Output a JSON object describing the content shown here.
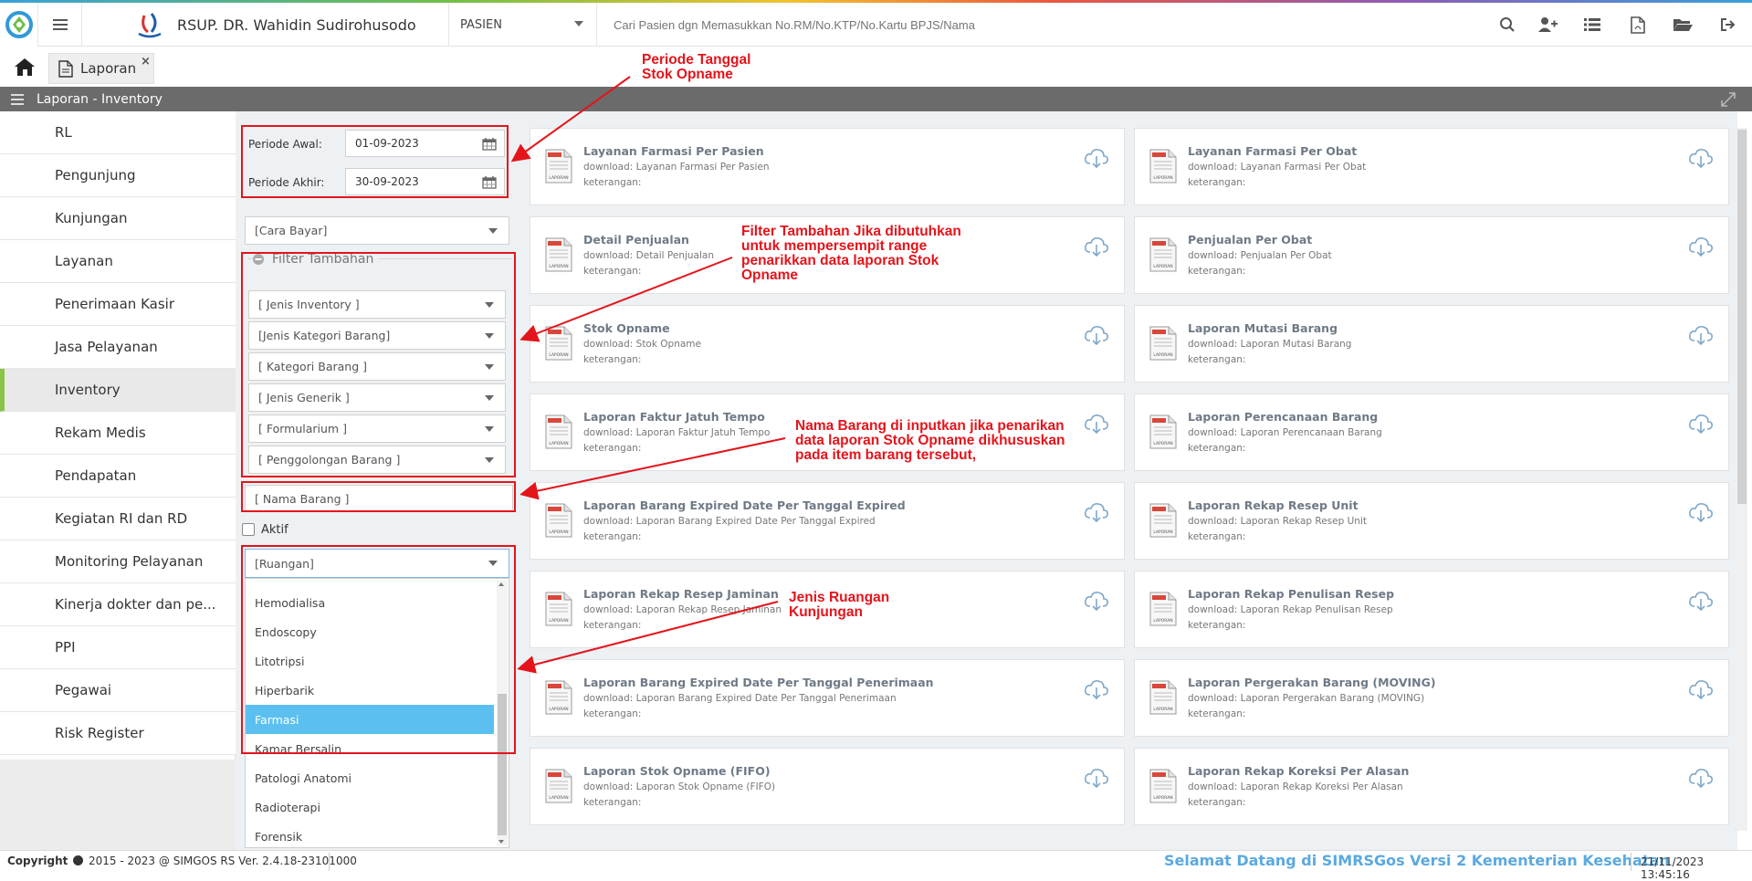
{
  "app": {
    "brand_title": "RSUP. DR. Wahidin Sudirohusodo",
    "patient_select_value": "PASIEN",
    "patient_search_placeholder": "Cari Pasien dgn Memasukkan No.RM/No.KTP/No.Kartu BPJS/Nama"
  },
  "tabs": {
    "laporan_label": "Laporan",
    "close_glyph": "×"
  },
  "section_header": {
    "title": "Laporan - Inventory"
  },
  "sidebar": {
    "items": [
      {
        "label": "RL"
      },
      {
        "label": "Pengunjung"
      },
      {
        "label": "Kunjungan"
      },
      {
        "label": "Layanan"
      },
      {
        "label": "Penerimaan Kasir"
      },
      {
        "label": "Jasa Pelayanan"
      },
      {
        "label": "Inventory"
      },
      {
        "label": "Rekam Medis"
      },
      {
        "label": "Pendapatan"
      },
      {
        "label": "Kegiatan RI dan RD"
      },
      {
        "label": "Monitoring Pelayanan"
      },
      {
        "label": "Kinerja dokter dan pe..."
      },
      {
        "label": "PPI"
      },
      {
        "label": "Pegawai"
      },
      {
        "label": "Risk Register"
      }
    ],
    "active": "Inventory"
  },
  "filters": {
    "periode_awal_label": "Periode Awal:",
    "periode_awal_value": "01-09-2023",
    "periode_akhir_label": "Periode Akhir:",
    "periode_akhir_value": "30-09-2023",
    "cara_bayar": "[Cara Bayar]",
    "filter_tambahan_legend": "Filter Tambahan",
    "jenis_inventory": "[ Jenis Inventory ]",
    "jenis_kategori_barang": "[Jenis Kategori Barang]",
    "kategori_barang": "[ Kategori Barang ]",
    "jenis_generik": "[ Jenis Generik ]",
    "formularium": "[ Formularium ]",
    "penggolongan_barang": "[ Penggolongan Barang ]",
    "nama_barang_placeholder": "[ Nama Barang ]",
    "aktif_label": "Aktif",
    "ruangan_placeholder": "[Ruangan]",
    "ruangan_options": [
      "Hemodialisa",
      "Endoscopy",
      "Litotripsi",
      "Hiperbarik",
      "Farmasi",
      "Kamar Bersalin",
      "Patologi Anatomi",
      "Radioterapi",
      "Forensik"
    ],
    "ruangan_highlighted": "Farmasi"
  },
  "reports": [
    {
      "title": "Layanan Farmasi Per Pasien",
      "download": "download: Layanan Farmasi Per Pasien",
      "ket": "keterangan:"
    },
    {
      "title": "Layanan Farmasi Per Obat",
      "download": "download: Layanan Farmasi Per Obat",
      "ket": "keterangan:"
    },
    {
      "title": "Detail Penjualan",
      "download": "download: Detail Penjualan",
      "ket": "keterangan:"
    },
    {
      "title": "Penjualan Per Obat",
      "download": "download: Penjualan Per Obat",
      "ket": "keterangan:"
    },
    {
      "title": "Stok Opname",
      "download": "download: Stok Opname",
      "ket": "keterangan:"
    },
    {
      "title": "Laporan Mutasi Barang",
      "download": "download: Laporan Mutasi Barang",
      "ket": "keterangan:"
    },
    {
      "title": "Laporan Faktur Jatuh Tempo",
      "download": "download: Laporan Faktur Jatuh Tempo",
      "ket": "keterangan:"
    },
    {
      "title": "Laporan Perencanaan Barang",
      "download": "download: Laporan Perencanaan Barang",
      "ket": "keterangan:"
    },
    {
      "title": "Laporan Barang Expired Date Per Tanggal Expired",
      "download": "download: Laporan Barang Expired Date Per Tanggal Expired",
      "ket": "keterangan:"
    },
    {
      "title": "Laporan Rekap Resep Unit",
      "download": "download: Laporan Rekap Resep Unit",
      "ket": "keterangan:"
    },
    {
      "title": "Laporan Rekap Resep Jaminan",
      "download": "download: Laporan Rekap Resep Jaminan",
      "ket": "keterangan:"
    },
    {
      "title": "Laporan Rekap Penulisan Resep",
      "download": "download: Laporan Rekap Penulisan Resep",
      "ket": "keterangan:"
    },
    {
      "title": "Laporan Barang Expired Date Per Tanggal Penerimaan",
      "download": "download: Laporan Barang Expired Date Per Tanggal Penerimaan",
      "ket": "keterangan:"
    },
    {
      "title": "Laporan Pergerakan Barang (MOVING)",
      "download": "download: Laporan Pergerakan Barang (MOVING)",
      "ket": "keterangan:"
    },
    {
      "title": "Laporan Stok Opname (FIFO)",
      "download": "download: Laporan Stok Opname (FIFO)",
      "ket": "keterangan:"
    },
    {
      "title": "Laporan Rekap Koreksi Per Alasan",
      "download": "download: Laporan Rekap Koreksi Per Alasan",
      "ket": "keterangan:"
    }
  ],
  "pdf_icon_label": "LAPORAN",
  "annotations": {
    "periode": "Periode Tanggal\nStok Opname",
    "filter": "Filter Tambahan Jika dibutuhkan\nuntuk mempersempit range\npenarikkan data laporan Stok\nOpname",
    "nama_barang": "Nama Barang di inputkan jika penarikan\ndata laporan Stok Opname dikhususkan\npada item barang tersebut,",
    "ruangan": "Jenis Ruangan\nKunjungan"
  },
  "footer": {
    "copyright_label": "Copyright",
    "copyright_text": "2015 - 2023 @ SIMGOS RS Ver. 2.4.18-23101000",
    "welcome": "Selamat Datang di SIMRSGos Versi 2 Kementerian Kesehatan",
    "datetime": "21/11/2023 13:45:16"
  },
  "colors": {
    "annotation": "#e4141b",
    "accent": "#8bc34a",
    "highlight": "#5bc0f0",
    "header": "#6b6b6b"
  }
}
